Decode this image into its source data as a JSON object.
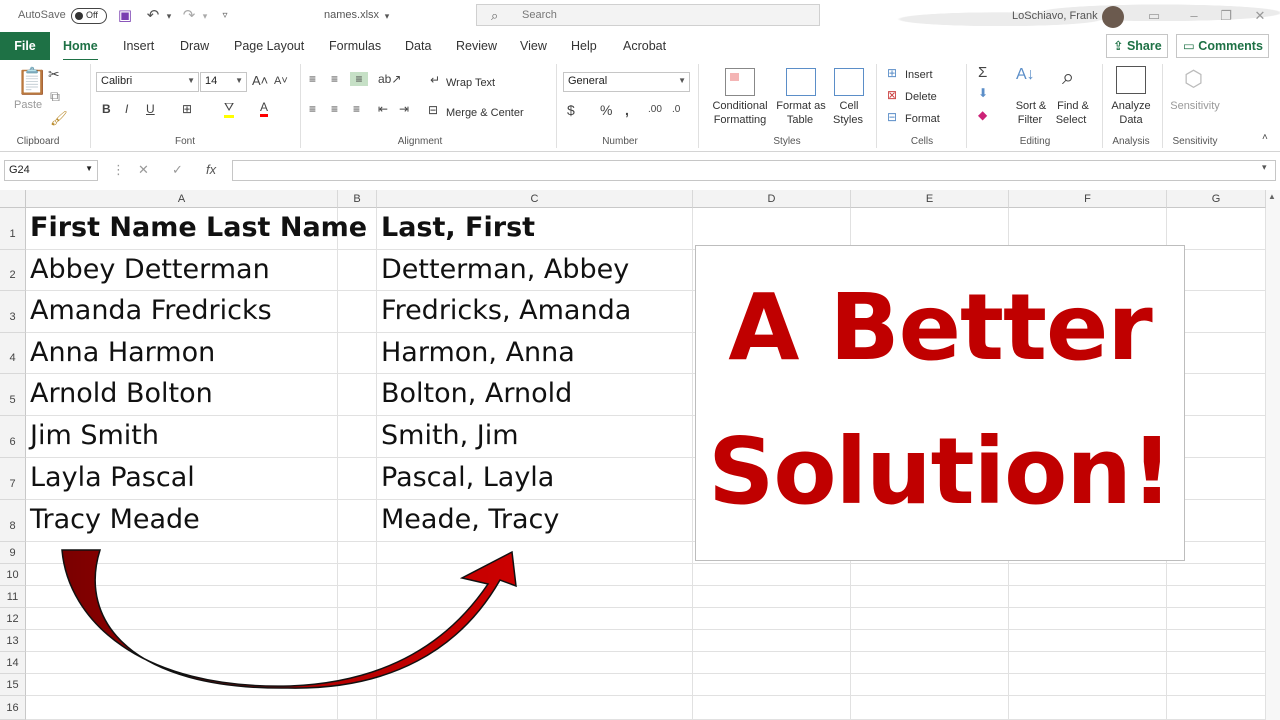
{
  "titlebar": {
    "autosave_label": "AutoSave",
    "autosave_state": "Off",
    "filename": "names.xlsx",
    "search_placeholder": "Search",
    "user_name": "LoSchiavo, Frank"
  },
  "tabs": [
    "File",
    "Home",
    "Insert",
    "Draw",
    "Page Layout",
    "Formulas",
    "Data",
    "Review",
    "View",
    "Help",
    "Acrobat"
  ],
  "active_tab": "Home",
  "share_label": "Share",
  "comments_label": "Comments",
  "ribbon": {
    "clipboard": {
      "paste": "Paste",
      "label": "Clipboard"
    },
    "font": {
      "name": "Calibri",
      "size": "14",
      "label": "Font"
    },
    "alignment": {
      "wrap_text": "Wrap Text",
      "merge_center": "Merge & Center",
      "label": "Alignment"
    },
    "number": {
      "format": "General",
      "label": "Number"
    },
    "styles": {
      "conditional_1": "Conditional",
      "conditional_2": "Formatting",
      "format_as_1": "Format as",
      "format_as_2": "Table",
      "cell_styles_1": "Cell",
      "cell_styles_2": "Styles",
      "label": "Styles"
    },
    "cells": {
      "insert": "Insert",
      "delete": "Delete",
      "format": "Format",
      "label": "Cells"
    },
    "editing": {
      "sort_1": "Sort &",
      "sort_2": "Filter",
      "find_1": "Find &",
      "find_2": "Select",
      "label": "Editing"
    },
    "analysis": {
      "analyze_1": "Analyze",
      "analyze_2": "Data",
      "label": "Analysis"
    },
    "sensitivity": {
      "button": "Sensitivity",
      "label": "Sensitivity"
    }
  },
  "formula_bar": {
    "name_box": "G24",
    "fx": "fx",
    "value": ""
  },
  "columns": [
    "A",
    "B",
    "C",
    "D",
    "E",
    "F",
    "G"
  ],
  "rows": [
    "1",
    "2",
    "3",
    "4",
    "5",
    "6",
    "7",
    "8",
    "9",
    "10",
    "11",
    "12",
    "13",
    "14",
    "15",
    "16"
  ],
  "cells": {
    "A1": "First Name Last Name",
    "C1": "Last, First",
    "A2": "Abbey Detterman",
    "C2": "Detterman, Abbey",
    "A3": "Amanda Fredricks",
    "C3": "Fredricks, Amanda",
    "A4": "Anna Harmon",
    "C4": "Harmon, Anna",
    "A5": "Arnold Bolton",
    "C5": "Bolton, Arnold",
    "A6": "Jim Smith",
    "C6": "Smith, Jim",
    "A7": "Layla Pascal",
    "C7": "Pascal, Layla",
    "A8": "Tracy Meade",
    "C8": "Meade, Tracy"
  },
  "callout": {
    "line1": "A Better",
    "line2": "Solution!",
    "color": "#c00000"
  },
  "accent_color": "#1e7145"
}
